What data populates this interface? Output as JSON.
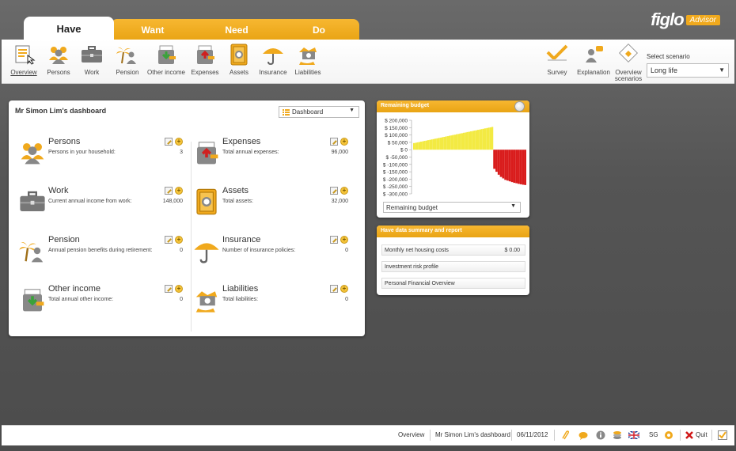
{
  "tabs": [
    {
      "label": "Have"
    },
    {
      "label": "Want"
    },
    {
      "label": "Need"
    },
    {
      "label": "Do"
    }
  ],
  "logo": {
    "brand": "figlo",
    "badge": "Advisor"
  },
  "toolbar": {
    "items": [
      {
        "label": "Overview",
        "icon": "overview-icon"
      },
      {
        "label": "Persons",
        "icon": "persons-icon"
      },
      {
        "label": "Work",
        "icon": "briefcase-icon"
      },
      {
        "label": "Pension",
        "icon": "pension-icon"
      },
      {
        "label": "Other income",
        "icon": "other-income-icon"
      },
      {
        "label": "Expenses",
        "icon": "expenses-icon"
      },
      {
        "label": "Assets",
        "icon": "safe-icon"
      },
      {
        "label": "Insurance",
        "icon": "umbrella-icon"
      },
      {
        "label": "Liabilities",
        "icon": "liabilities-icon"
      }
    ],
    "right": [
      {
        "label": "Survey",
        "icon": "survey-icon"
      },
      {
        "label": "Explanation",
        "icon": "explanation-icon"
      },
      {
        "label": "Overview",
        "label2": "scenarios",
        "icon": "scenarios-icon"
      }
    ],
    "scenario_label": "Select scenario",
    "scenario_value": "Long life"
  },
  "dashboard": {
    "title": "Mr Simon Lim's dashboard",
    "select_value": "Dashboard",
    "cards": [
      {
        "name": "Persons",
        "desc": "Persons in your household:",
        "value": "3"
      },
      {
        "name": "Expenses",
        "desc": "Total annual expenses:",
        "value": "96,000"
      },
      {
        "name": "Work",
        "desc": "Current annual income from work:",
        "value": "148,000"
      },
      {
        "name": "Assets",
        "desc": "Total assets:",
        "value": "32,000"
      },
      {
        "name": "Pension",
        "desc": "Annual pension benefits during retirement:",
        "value": "0"
      },
      {
        "name": "Insurance",
        "desc": "Number of insurance policies:",
        "value": "0"
      },
      {
        "name": "Other income",
        "desc": "Total annual other income:",
        "value": "0"
      },
      {
        "name": "Liabilities",
        "desc": "Total liabilities:",
        "value": "0"
      }
    ]
  },
  "budget": {
    "title": "Remaining budget",
    "select_value": "Remaining budget"
  },
  "chart_data": {
    "type": "bar",
    "title": "",
    "ylim": [
      -300000,
      200000
    ],
    "yticks": [
      "$ 200,000",
      "$ 150,000",
      "$ 100,000",
      "$ 50,000",
      "$ 0",
      "$ -50,000",
      "$ -100,000",
      "$ -150,000",
      "$ -200,000",
      "$ -250,000",
      "$ -300,000"
    ],
    "ytick_values": [
      200000,
      150000,
      100000,
      50000,
      0,
      -50000,
      -100000,
      -150000,
      -200000,
      -250000,
      -300000
    ],
    "positive_color": "#f3ea43",
    "negative_color": "#d91c1c",
    "positive_values": [
      45000,
      47000,
      50000,
      52000,
      55000,
      57000,
      60000,
      62000,
      65000,
      67000,
      70000,
      72000,
      75000,
      77000,
      80000,
      82000,
      85000,
      87000,
      90000,
      92000,
      95000,
      97000,
      100000,
      102000,
      105000,
      107000,
      110000,
      112000,
      115000,
      117000,
      120000,
      122000,
      125000,
      127000,
      130000,
      132000,
      135000,
      137000,
      140000,
      142000,
      145000,
      147000,
      150000,
      152000,
      155000
    ],
    "negative_values": [
      -130000,
      -150000,
      -170000,
      -185000,
      -195000,
      -205000,
      -210000,
      -215000,
      -220000,
      -225000,
      -228000,
      -232000,
      -235000,
      -238000,
      -240000,
      -242000,
      -244000,
      -246000,
      -248000,
      -250000
    ]
  },
  "summary": {
    "title": "Have data summary and report",
    "rows": [
      {
        "label": "Monthly net housing costs",
        "amount": "$  0.00"
      },
      {
        "label": "Investment risk profile",
        "amount": ""
      },
      {
        "label": "Personal Financial Overview",
        "amount": ""
      }
    ]
  },
  "statusbar": {
    "section": "Overview",
    "client": "Mr Simon Lim's dashboard",
    "date": "06/11/2012",
    "country": "SG",
    "quit": "Quit"
  }
}
